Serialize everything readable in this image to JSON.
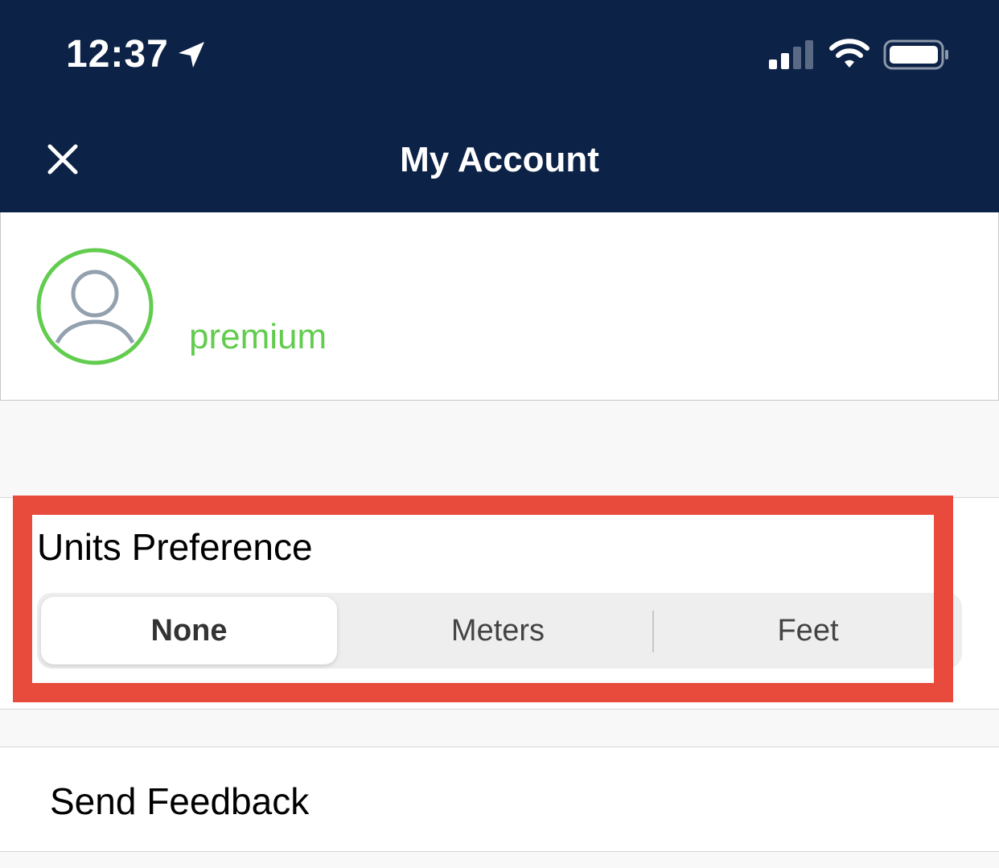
{
  "status_bar": {
    "time": "12:37",
    "icons": [
      "location-arrow-icon",
      "cellular-signal-icon",
      "wifi-icon",
      "battery-icon"
    ]
  },
  "nav": {
    "title": "My Account",
    "close_icon": "close-icon"
  },
  "profile": {
    "avatar_icon": "user-avatar-icon",
    "tier": "premium"
  },
  "units": {
    "title": "Units Preference",
    "options": [
      "None",
      "Meters",
      "Feet"
    ],
    "selected": "None"
  },
  "feedback": {
    "label": "Send Feedback"
  },
  "colors": {
    "header_bg": "#0c2246",
    "accent_green": "#62cc4e",
    "highlight_red": "#e84a3c"
  }
}
